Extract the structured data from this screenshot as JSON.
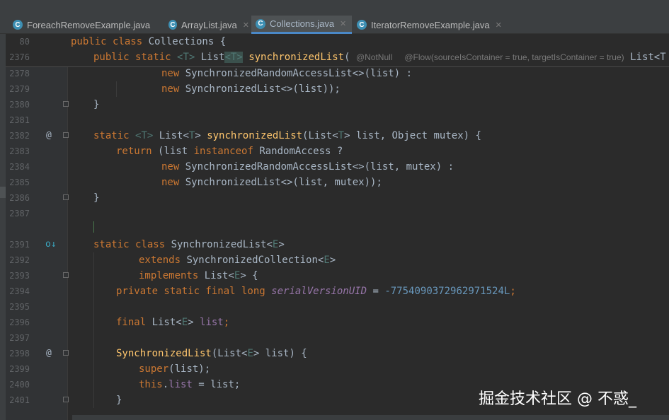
{
  "tabs": [
    {
      "label": "ForeachRemoveExample.java",
      "active": false,
      "icon": "C"
    },
    {
      "label": "ArrayList.java",
      "active": false,
      "icon": "C"
    },
    {
      "label": "Collections.java",
      "active": true,
      "icon": "C"
    },
    {
      "label": "IteratorRemoveExample.java",
      "active": false,
      "icon": "C"
    }
  ],
  "sticky": {
    "line_80": "80",
    "line_2376": "2376",
    "class_header": "public class Collections {",
    "method_header_kw": "public static ",
    "method_header_tp": "<T>",
    "method_header_ret": " List",
    "method_header_ret_tp": "<T>",
    "method_header_name": "synchronizedList",
    "method_header_paren": "(",
    "annotation_notnull": "@NotNull",
    "annotation_flow": "@Flow(sourceIsContainer = true, targetIsContainer = true)",
    "param_type_trunc": "List<T"
  },
  "line_numbers": [
    "2378",
    "2379",
    "2380",
    "2381",
    "2382",
    "2383",
    "2384",
    "2385",
    "2386",
    "2387",
    "2391",
    "2392",
    "2393",
    "2394",
    "2395",
    "2396",
    "2397",
    "2398",
    "2399",
    "2400",
    "2401"
  ],
  "code": {
    "l2378_kw": "new ",
    "l2378_rest": "SynchronizedRandomAccessList<>(list) :",
    "l2379_kw": "new ",
    "l2379_rest": "SynchronizedList<>(list));",
    "l2380": "}",
    "l2382_kw": "static ",
    "l2382_tp": "<T>",
    "l2382_a": " List<",
    "l2382_tp2": "T",
    "l2382_b": "> ",
    "l2382_fn": "synchronizedList",
    "l2382_c": "(List<",
    "l2382_tp3": "T",
    "l2382_d": "> list, Object mutex) {",
    "l2383_kw": "return ",
    "l2383_a": "(list ",
    "l2383_kw2": "instanceof ",
    "l2383_b": "RandomAccess ?",
    "l2384_kw": "new ",
    "l2384_rest": "SynchronizedRandomAccessList<>(list, mutex) :",
    "l2385_kw": "new ",
    "l2385_rest": "SynchronizedList<>(list, mutex));",
    "l2386": "}",
    "l2391_kw": "static class ",
    "l2391_a": "SynchronizedList<",
    "l2391_tp": "E",
    "l2391_b": ">",
    "l2392_kw": "extends ",
    "l2392_a": "SynchronizedCollection<",
    "l2392_tp": "E",
    "l2392_b": ">",
    "l2393_kw": "implements ",
    "l2393_a": "List<",
    "l2393_tp": "E",
    "l2393_b": "> {",
    "l2394_kw": "private static final long ",
    "l2394_fld": "serialVersionUID",
    "l2394_a": " = ",
    "l2394_num": "-7754090372962971524L",
    "l2394_b": ";",
    "l2396_kw": "final ",
    "l2396_a": "List<",
    "l2396_tp": "E",
    "l2396_b": "> ",
    "l2396_fld": "list",
    "l2396_c": ";",
    "l2398_fn": "SynchronizedList",
    "l2398_a": "(List<",
    "l2398_tp": "E",
    "l2398_b": "> list) {",
    "l2399_kw": "super",
    "l2399_a": "(list);",
    "l2400_kw": "this",
    "l2400_a": ".",
    "l2400_fld": "list",
    "l2400_b": " = list;",
    "l2401": "}"
  },
  "gutter_icons": {
    "at_symbol": "@",
    "override_down": "o↓"
  },
  "watermark": "掘金技术社区 @ 不惑_",
  "colors": {
    "background": "#2b2b2b",
    "keyword": "#cc7832",
    "method": "#ffc66d",
    "type_param": "#507874",
    "number": "#6897bb",
    "field": "#9876aa",
    "tab_accent": "#4a88c7"
  }
}
